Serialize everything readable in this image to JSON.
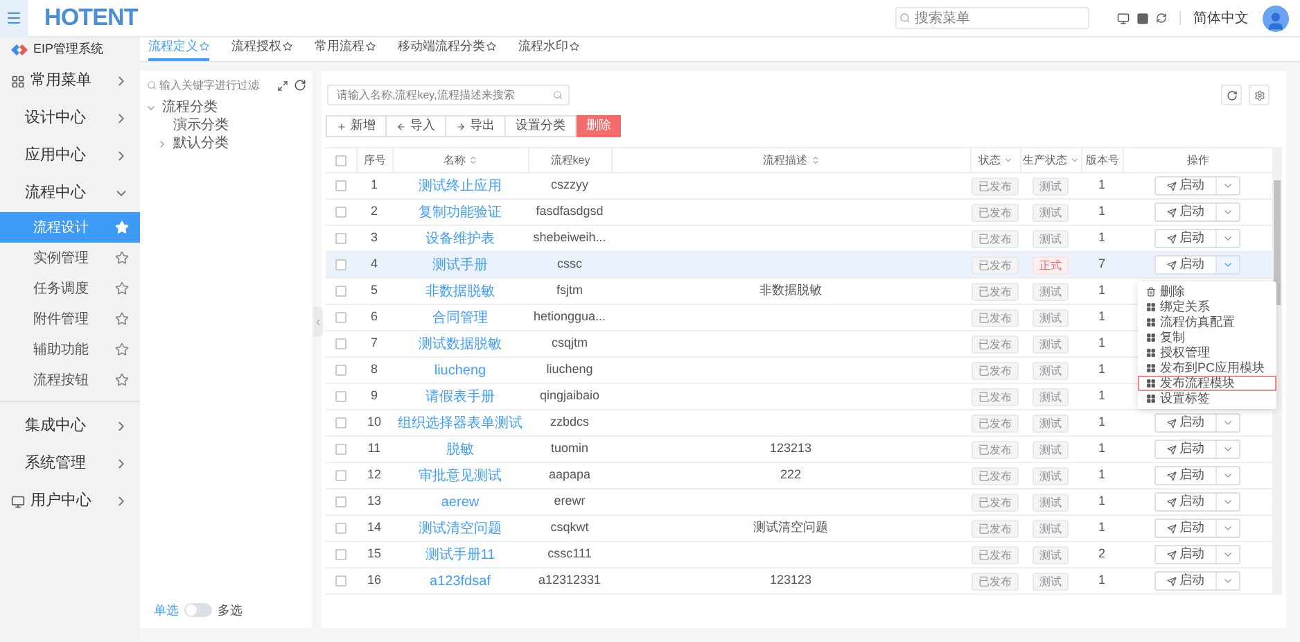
{
  "header": {
    "logo": "HOTENT",
    "search": {
      "placeholder": "搜索菜单"
    },
    "language": "简体中文"
  },
  "sidebar": {
    "brand": "EIP管理系统",
    "items": [
      {
        "label": "常用菜单",
        "kind": "grid",
        "expanded": false
      },
      {
        "label": "设计中心",
        "kind": "plain",
        "expanded": false
      },
      {
        "label": "应用中心",
        "kind": "plain",
        "expanded": false
      },
      {
        "label": "流程中心",
        "kind": "plain",
        "expanded": true,
        "children": [
          {
            "label": "流程设计",
            "selected": true
          },
          {
            "label": "实例管理",
            "selected": false
          },
          {
            "label": "任务调度",
            "selected": false
          },
          {
            "label": "附件管理",
            "selected": false
          },
          {
            "label": "辅助功能",
            "selected": false
          },
          {
            "label": "流程按钮",
            "selected": false
          }
        ]
      },
      {
        "label": "集成中心",
        "kind": "plain",
        "expanded": false
      },
      {
        "label": "系统管理",
        "kind": "plain",
        "expanded": false
      },
      {
        "label": "用户中心",
        "kind": "monitor",
        "expanded": false
      }
    ]
  },
  "tabs": [
    {
      "label": "流程定义",
      "selected": true
    },
    {
      "label": "流程授权",
      "selected": false
    },
    {
      "label": "常用流程",
      "selected": false
    },
    {
      "label": "移动端流程分类",
      "selected": false
    },
    {
      "label": "流程水印",
      "selected": false
    }
  ],
  "tree": {
    "filter": {
      "placeholder": "输入关键字进行过滤"
    },
    "nodes": [
      {
        "label": "流程分类",
        "expanded": true,
        "children": [
          {
            "label": "演示分类"
          },
          {
            "label": "默认分类",
            "expanded": false
          }
        ]
      }
    ],
    "mode": {
      "left": "单选",
      "right": "多选",
      "on": false
    }
  },
  "toolbar": {
    "search": {
      "placeholder": "请输入名称,流程key,流程描述来搜索"
    },
    "buttons": [
      {
        "label": "新增",
        "kind": "add"
      },
      {
        "label": "导入",
        "kind": "import"
      },
      {
        "label": "导出",
        "kind": "export"
      },
      {
        "label": "设置分类",
        "kind": "plain"
      },
      {
        "label": "删除",
        "kind": "danger"
      }
    ]
  },
  "table": {
    "header_checked": false,
    "columns": [
      "序号",
      "名称",
      "流程key",
      "流程描述",
      "状态",
      "生产状态",
      "版本号",
      "操作"
    ],
    "rows": [
      {
        "index": "1",
        "name": "测试终止应用",
        "key": "cszzyy",
        "desc": "",
        "status": "已发布",
        "production": {
          "text": "测试",
          "kind": "test"
        },
        "version": "1",
        "action": "启动",
        "checked": false,
        "selected": false
      },
      {
        "index": "2",
        "name": "复制功能验证",
        "key": "fasdfasdgsd",
        "desc": "",
        "status": "已发布",
        "production": {
          "text": "测试",
          "kind": "test"
        },
        "version": "1",
        "action": "启动",
        "checked": false,
        "selected": false
      },
      {
        "index": "3",
        "name": "设备维护表",
        "key": "shebeiweih...",
        "desc": "",
        "status": "已发布",
        "production": {
          "text": "测试",
          "kind": "test"
        },
        "version": "1",
        "action": "启动",
        "checked": false,
        "selected": false
      },
      {
        "index": "4",
        "name": "测试手册",
        "key": "cssc",
        "desc": "",
        "status": "已发布",
        "production": {
          "text": "正式",
          "kind": "formal"
        },
        "version": "7",
        "action": "启动",
        "checked": false,
        "selected": true
      },
      {
        "index": "5",
        "name": "非数据脱敏",
        "key": "fsjtm",
        "desc": "非数据脱敏",
        "status": "已发布",
        "production": {
          "text": "测试",
          "kind": "test"
        },
        "version": "1",
        "checked": false,
        "selected": false
      },
      {
        "index": "6",
        "name": "合同管理",
        "key": "hetiongguа...",
        "desc": "",
        "status": "已发布",
        "production": {
          "text": "测试",
          "kind": "test"
        },
        "version": "1",
        "checked": false,
        "selected": false
      },
      {
        "index": "7",
        "name": "测试数据脱敏",
        "key": "csqjtm",
        "desc": "",
        "status": "已发布",
        "production": {
          "text": "测试",
          "kind": "test"
        },
        "version": "1",
        "checked": false,
        "selected": false
      },
      {
        "index": "8",
        "name": "liucheng",
        "key": "liucheng",
        "desc": "",
        "status": "已发布",
        "production": {
          "text": "测试",
          "kind": "test"
        },
        "version": "1",
        "checked": false,
        "selected": false
      },
      {
        "index": "9",
        "name": "请假表手册",
        "key": "qingjaibaio",
        "desc": "",
        "status": "已发布",
        "production": {
          "text": "测试",
          "kind": "test"
        },
        "version": "1",
        "checked": false,
        "selected": false
      },
      {
        "index": "10",
        "name": "组织选择器表单测试",
        "key": "zzbdcs",
        "desc": "",
        "status": "已发布",
        "production": {
          "text": "测试",
          "kind": "test"
        },
        "version": "1",
        "action": "启动",
        "checked": false,
        "selected": false
      },
      {
        "index": "11",
        "name": "脱敏",
        "key": "tuomin",
        "desc": "123213",
        "status": "已发布",
        "production": {
          "text": "测试",
          "kind": "test"
        },
        "version": "1",
        "action": "启动",
        "checked": false,
        "selected": false
      },
      {
        "index": "12",
        "name": "审批意见测试",
        "key": "aapapa",
        "desc": "222",
        "status": "已发布",
        "production": {
          "text": "测试",
          "kind": "test"
        },
        "version": "1",
        "action": "启动",
        "checked": false,
        "selected": false
      },
      {
        "index": "13",
        "name": "aerew",
        "key": "erewr",
        "desc": "",
        "status": "已发布",
        "production": {
          "text": "测试",
          "kind": "test"
        },
        "version": "1",
        "action": "启动",
        "checked": false,
        "selected": false
      },
      {
        "index": "14",
        "name": "测试清空问题",
        "key": "csqkwt",
        "desc": "测试清空问题",
        "status": "已发布",
        "production": {
          "text": "测试",
          "kind": "test"
        },
        "version": "1",
        "action": "启动",
        "checked": false,
        "selected": false
      },
      {
        "index": "15",
        "name": "测试手册11",
        "key": "cssc111",
        "desc": "",
        "status": "已发布",
        "production": {
          "text": "测试",
          "kind": "test"
        },
        "version": "2",
        "action": "启动",
        "checked": false,
        "selected": false
      },
      {
        "index": "16",
        "name": "a123fdsaf",
        "key": "a12312331",
        "desc": "123123",
        "status": "已发布",
        "production": {
          "text": "测试",
          "kind": "test"
        },
        "version": "1",
        "action": "启动",
        "checked": false,
        "selected": false
      }
    ]
  },
  "menu": [
    {
      "label": "删除",
      "kind": "delete",
      "selected": false
    },
    {
      "label": "绑定关系",
      "kind": "grid",
      "selected": false
    },
    {
      "label": "流程仿真配置",
      "kind": "grid",
      "selected": false
    },
    {
      "label": "复制",
      "kind": "grid",
      "selected": false
    },
    {
      "label": "授权管理",
      "kind": "grid",
      "selected": false
    },
    {
      "label": "发布到PC应用模块",
      "kind": "grid",
      "selected": false
    },
    {
      "label": "发布流程模块",
      "kind": "grid",
      "selected": true
    },
    {
      "label": "设置标签",
      "kind": "grid",
      "selected": false
    }
  ]
}
